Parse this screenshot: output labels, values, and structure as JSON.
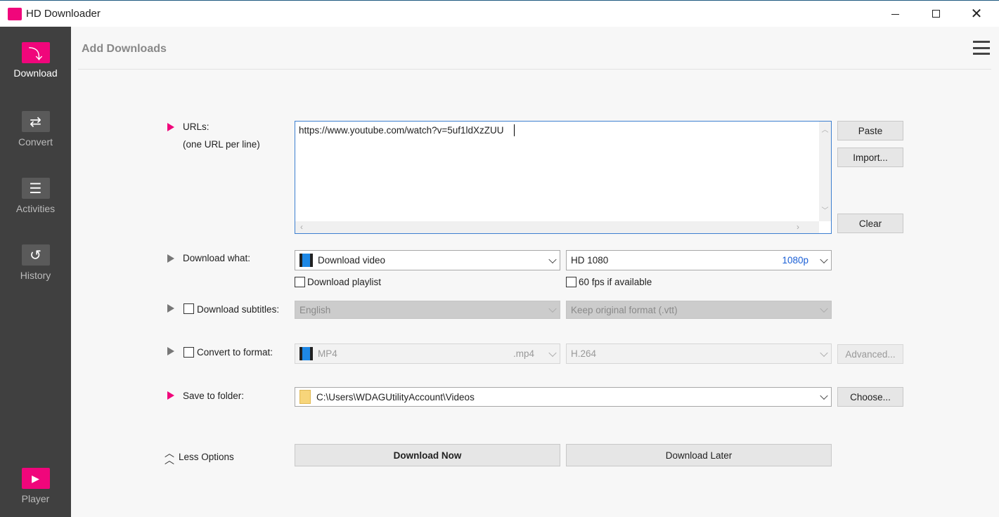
{
  "window": {
    "title": "HD Downloader"
  },
  "sidebar": {
    "items": [
      {
        "label": "Download"
      },
      {
        "label": "Convert"
      },
      {
        "label": "Activities"
      },
      {
        "label": "History"
      },
      {
        "label": "Player"
      }
    ]
  },
  "header": {
    "title": "Add Downloads"
  },
  "urls": {
    "label": "URLs:",
    "hint": "(one URL per line)",
    "value": "https://www.youtube.com/watch?v=5uf1ldXzZUU",
    "paste": "Paste",
    "import": "Import...",
    "clear": "Clear"
  },
  "download_what": {
    "label": "Download what:",
    "value": "Download video",
    "quality": "HD 1080",
    "quality_tag": "1080p",
    "playlist": "Download playlist",
    "fps": "60 fps if available"
  },
  "subtitles": {
    "label": "Download subtitles:",
    "language": "English",
    "format": "Keep original format (.vtt)"
  },
  "convert": {
    "label": "Convert to format:",
    "format": "MP4",
    "ext": ".mp4",
    "codec": "H.264",
    "advanced": "Advanced..."
  },
  "folder": {
    "label": "Save to folder:",
    "value": "C:\\Users\\WDAGUtilityAccount\\Videos",
    "choose": "Choose..."
  },
  "actions": {
    "less": "Less Options",
    "now": "Download Now",
    "later": "Download Later"
  },
  "colors": {
    "accent": "#f0067b",
    "sidebar": "#404040"
  }
}
